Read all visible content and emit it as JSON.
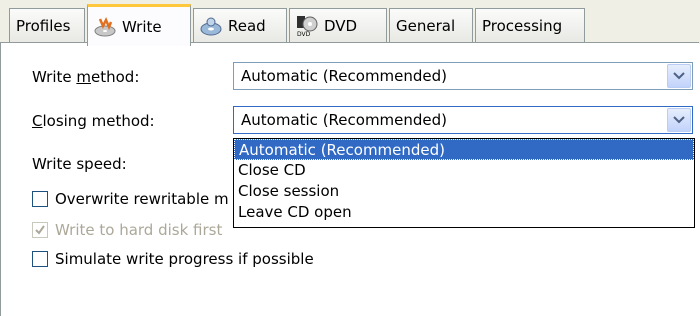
{
  "tabs": [
    {
      "label": "Profiles",
      "icon": ""
    },
    {
      "label": "Write",
      "icon": "write-disc-icon"
    },
    {
      "label": "Read",
      "icon": "read-disc-icon"
    },
    {
      "label": "DVD",
      "icon": "dvd-icon"
    },
    {
      "label": "General",
      "icon": ""
    },
    {
      "label": "Processing",
      "icon": ""
    }
  ],
  "active_tab": "Write",
  "write_method": {
    "label_prefix": "Write ",
    "label_mnemonic": "m",
    "label_suffix": "ethod:",
    "value": "Automatic (Recommended)"
  },
  "closing_method": {
    "label_mnemonic": "C",
    "label_suffix": "losing method:",
    "value": "Automatic (Recommended)",
    "options": [
      "Automatic (Recommended)",
      "Close CD",
      "Close session",
      "Leave CD open"
    ],
    "selected_index": 0
  },
  "write_speed": {
    "label": "Write speed:"
  },
  "checkboxes": [
    {
      "label": "Overwrite rewritable m",
      "checked": false,
      "disabled": false
    },
    {
      "label": "Write to hard disk first",
      "checked": true,
      "disabled": true
    },
    {
      "label": "Simulate write progress if possible",
      "checked": false,
      "disabled": false
    }
  ],
  "colors": {
    "selection": "#316ac5",
    "tab_highlight": "#ffc83c",
    "combo_border": "#7f9db9"
  }
}
